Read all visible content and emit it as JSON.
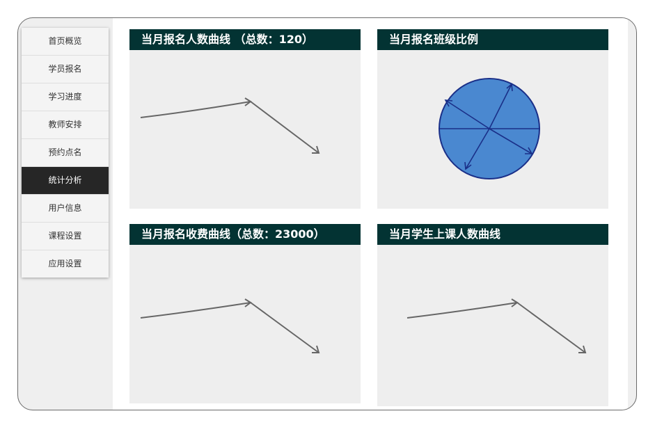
{
  "sidebar": {
    "items": [
      {
        "label": "首页概览"
      },
      {
        "label": "学员报名"
      },
      {
        "label": "学习进度"
      },
      {
        "label": "教师安排"
      },
      {
        "label": "预约点名"
      },
      {
        "label": "统计分析"
      },
      {
        "label": "用户信息"
      },
      {
        "label": "课程设置"
      },
      {
        "label": "应用设置"
      }
    ],
    "active_index": 5
  },
  "panels": [
    {
      "title": "当月报名人数曲线 （总数：120）"
    },
    {
      "title": "当月报名班级比例"
    },
    {
      "title": "当月报名收费曲线（总数：23000）"
    },
    {
      "title": "当月学生上课人数曲线"
    }
  ],
  "colors": {
    "header_bg": "#033333",
    "active_nav_bg": "#262626",
    "pie_fill": "#4a88d0",
    "pie_stroke": "#1a2f88",
    "line_stroke": "#666666"
  }
}
